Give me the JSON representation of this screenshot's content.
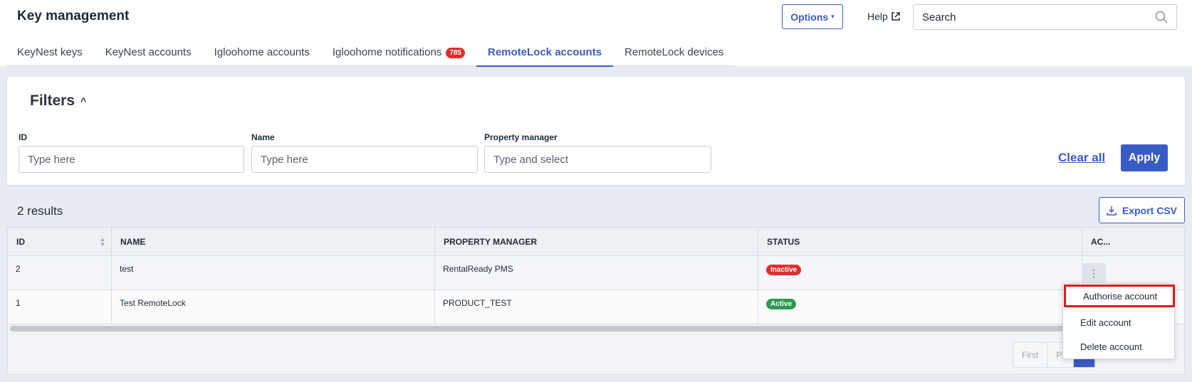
{
  "header": {
    "title": "Key management",
    "options_label": "Options",
    "help_label": "Help",
    "search_placeholder": "Search"
  },
  "tabs": [
    {
      "label": "KeyNest keys"
    },
    {
      "label": "KeyNest accounts"
    },
    {
      "label": "Igloohome accounts"
    },
    {
      "label": "Igloohome notifications",
      "badge": "785"
    },
    {
      "label": "RemoteLock accounts",
      "active": true
    },
    {
      "label": "RemoteLock devices"
    }
  ],
  "filters": {
    "title": "Filters",
    "id_label": "ID",
    "id_placeholder": "Type here",
    "name_label": "Name",
    "name_placeholder": "Type here",
    "pm_label": "Property manager",
    "pm_placeholder": "Type and select",
    "clear_all": "Clear all",
    "apply": "Apply"
  },
  "results": {
    "count": "2 results",
    "export_label": "Export CSV"
  },
  "table": {
    "columns": [
      "ID",
      "NAME",
      "PROPERTY MANAGER",
      "STATUS",
      "AC..."
    ],
    "rows": [
      {
        "id": "2",
        "name": "test",
        "pm": "RentalReady PMS",
        "status": "Inactive"
      },
      {
        "id": "1",
        "name": "Test RemoteLock",
        "pm": "PRODUCT_TEST",
        "status": "Active"
      }
    ]
  },
  "pager": {
    "first": "First",
    "prev": "Pr"
  },
  "menu": {
    "items": [
      "Authorise account",
      "Edit account",
      "Delete account"
    ]
  },
  "colors": {
    "accent": "#3b5bc4",
    "inactive": "#e02d2d",
    "active": "#2b9a54",
    "highlight": "#e01818"
  }
}
